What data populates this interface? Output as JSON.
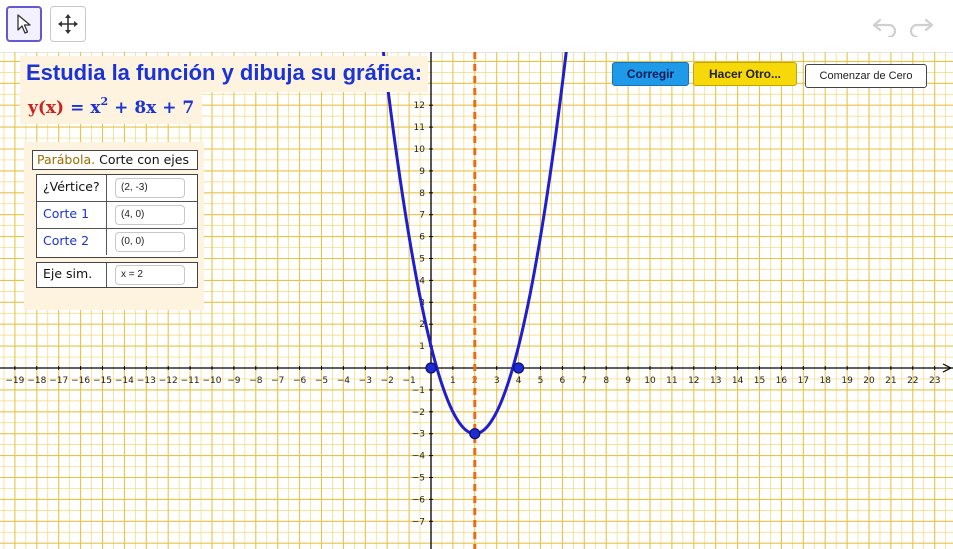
{
  "toolbar": {
    "tools": [
      {
        "name": "move-tool",
        "icon": "arrow-cursor-icon",
        "active": true
      },
      {
        "name": "move-graphics-view-tool",
        "icon": "four-arrows-icon",
        "active": false
      }
    ],
    "undo_icon": "undo-icon",
    "redo_icon": "redo-icon"
  },
  "title": "Estudia la función y dibuja su gráfica:",
  "formula": {
    "label": "y(x)",
    "equals": "=",
    "term1": "x",
    "exponent": "2",
    "rest": "+ 8x + 7"
  },
  "panel": {
    "heading_part1": "Parábola.",
    "heading_part2": "Corte con ejes",
    "rows": [
      {
        "label": "¿Vértice?",
        "value": "(2, -3)",
        "label_color": "#111111"
      },
      {
        "label": "Corte 1",
        "value": "(4, 0)",
        "label_color": "#1a33d9"
      },
      {
        "label": "Corte 2",
        "value": "(0, 0)",
        "label_color": "#1a33d9"
      }
    ],
    "axis": {
      "label": "Eje sim.",
      "value": "x = 2"
    }
  },
  "buttons": {
    "corregir": "Corregir",
    "hacer_otro": "Hacer Otro...",
    "comenzar": "Comenzar de Cero"
  },
  "colors": {
    "grid_minor": "#f3d87a",
    "grid_major": "#e7c34a",
    "axis": "#000000",
    "curve": "#1f1fd1",
    "symmetry_line": "#ee6a12",
    "point": "#1f2bd1"
  },
  "chart_data": {
    "type": "line",
    "x_range": [
      -19,
      23
    ],
    "y_range": [
      -7,
      12
    ],
    "x_ticks": [
      -19,
      -18,
      -17,
      -16,
      -15,
      -14,
      -13,
      -12,
      -11,
      -10,
      -9,
      -8,
      -7,
      -6,
      -5,
      -4,
      -3,
      -2,
      -1,
      1,
      2,
      3,
      4,
      5,
      6,
      7,
      8,
      9,
      10,
      11,
      12,
      13,
      14,
      15,
      16,
      17,
      18,
      19,
      20,
      21,
      22,
      23
    ],
    "y_ticks": [
      -7,
      -6,
      -5,
      -4,
      -3,
      -2,
      -1,
      1,
      2,
      3,
      4,
      5,
      6,
      7,
      8,
      9,
      10,
      11,
      12
    ],
    "curve": {
      "a": 1,
      "h": 2,
      "k": -3
    },
    "symmetry_x": 2,
    "points": [
      {
        "x": 0,
        "y": 0
      },
      {
        "x": 4,
        "y": 0
      },
      {
        "x": 2,
        "y": -3
      }
    ]
  }
}
